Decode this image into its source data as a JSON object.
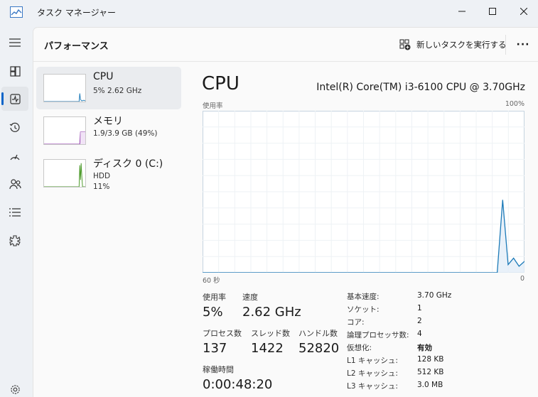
{
  "window": {
    "title": "タスク マネージャー",
    "controls": [
      "minimize-icon",
      "maximize-icon",
      "close-icon"
    ]
  },
  "nav": {
    "items": [
      {
        "name": "nav-menu",
        "icon": "hamburger-icon"
      },
      {
        "name": "nav-processes",
        "icon": "processes-icon"
      },
      {
        "name": "nav-performance",
        "icon": "performance-icon",
        "active": true
      },
      {
        "name": "nav-app-history",
        "icon": "history-icon"
      },
      {
        "name": "nav-startup-apps",
        "icon": "startup-icon"
      },
      {
        "name": "nav-users",
        "icon": "users-icon"
      },
      {
        "name": "nav-details",
        "icon": "details-icon"
      },
      {
        "name": "nav-services",
        "icon": "services-icon"
      },
      {
        "name": "nav-settings",
        "icon": "gear-icon"
      }
    ],
    "accent": "#0a64c8"
  },
  "header": {
    "title": "パフォーマンス",
    "run_task_label": "新しいタスクを実行する",
    "more_label": "···"
  },
  "resources": [
    {
      "name": "CPU",
      "line1": "5%  2.62 GHz",
      "line2": "",
      "color": "#1c7ab8",
      "selected": true
    },
    {
      "name": "メモリ",
      "line1": "1.9/3.9 GB (49%)",
      "line2": "",
      "color": "#8b32a8"
    },
    {
      "name": "ディスク 0 (C:)",
      "line1": "HDD",
      "line2": "11%",
      "color": "#4c9a2a"
    }
  ],
  "detail": {
    "title": "CPU",
    "model": "Intel(R) Core(TM) i3-6100 CPU @ 3.70GHz",
    "graph_top_left": "使用率",
    "graph_top_right": "100%",
    "graph_bottom_left": "60 秒",
    "graph_bottom_right": "0",
    "usage": [
      0,
      0,
      0,
      0,
      0,
      0,
      0,
      0,
      0,
      0,
      0,
      0,
      0,
      0,
      0,
      0,
      0,
      0,
      0,
      0,
      0,
      0,
      0,
      0,
      0,
      0,
      0,
      0,
      0,
      0,
      0,
      0,
      0,
      0,
      0,
      0,
      0,
      0,
      0,
      0,
      0,
      0,
      0,
      0,
      0,
      0,
      0,
      0,
      0,
      0,
      0,
      0,
      0,
      0,
      0,
      45,
      5,
      9,
      4,
      7
    ],
    "graph_color": "#1c7ab8",
    "stats": {
      "usage_label": "使用率",
      "usage_value": "5%",
      "speed_label": "速度",
      "speed_value": "2.62 GHz",
      "processes_label": "プロセス数",
      "processes_value": "137",
      "threads_label": "スレッド数",
      "threads_value": "1422",
      "handles_label": "ハンドル数",
      "handles_value": "52820",
      "uptime_label": "稼働時間",
      "uptime_value": "0:00:48:20"
    },
    "specs": [
      {
        "label": "基本速度:",
        "value": "3.70 GHz",
        "bold": false
      },
      {
        "label": "ソケット:",
        "value": "1",
        "bold": false
      },
      {
        "label": "コア:",
        "value": "2",
        "bold": false
      },
      {
        "label": "論理プロセッサ数:",
        "value": "4",
        "bold": false
      },
      {
        "label": "仮想化:",
        "value": "有効",
        "bold": true
      },
      {
        "label": "L1 キャッシュ:",
        "value": "128 KB",
        "bold": false
      },
      {
        "label": "L2 キャッシュ:",
        "value": "512 KB",
        "bold": false
      },
      {
        "label": "L3 キャッシュ:",
        "value": "3.0 MB",
        "bold": false
      }
    ]
  }
}
